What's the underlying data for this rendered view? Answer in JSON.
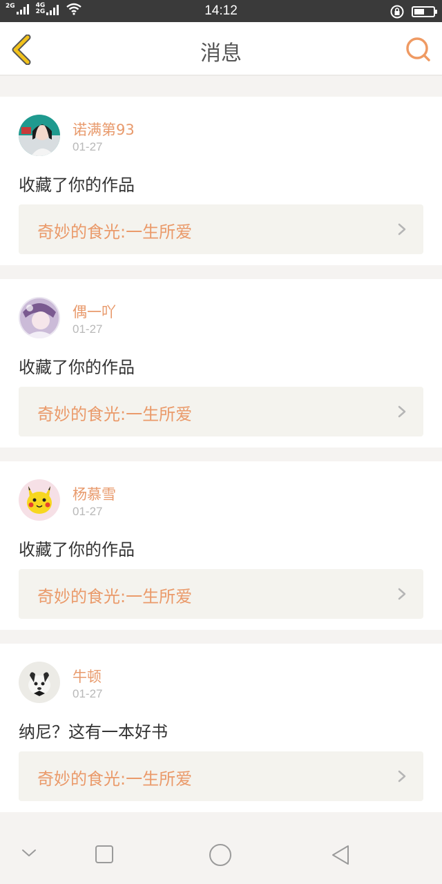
{
  "status_bar": {
    "network_left": "2G",
    "network_right_top": "4G",
    "network_right_bottom": "2G",
    "time": "14:12",
    "battery_level": 0.55
  },
  "header": {
    "title": "消息",
    "back_icon": "chevron-left-icon",
    "search_icon": "search-icon"
  },
  "messages": [
    {
      "username": "诺满第93",
      "date": "01-27",
      "action": "收藏了你的作品",
      "work_title": "奇妙的食光:一生所爱"
    },
    {
      "username": "偶一吖",
      "date": "01-27",
      "action": "收藏了你的作品",
      "work_title": "奇妙的食光:一生所爱"
    },
    {
      "username": "杨慕雪",
      "date": "01-27",
      "action": "收藏了你的作品",
      "work_title": "奇妙的食光:一生所爱"
    },
    {
      "username": "牛顿",
      "date": "01-27",
      "action": "纳尼？这有一本好书",
      "work_title": "奇妙的食光:一生所爱"
    }
  ],
  "colors": {
    "accent": "#e89a6c",
    "back_icon": "#f2c21b",
    "link_bg": "#f4f3ee"
  }
}
